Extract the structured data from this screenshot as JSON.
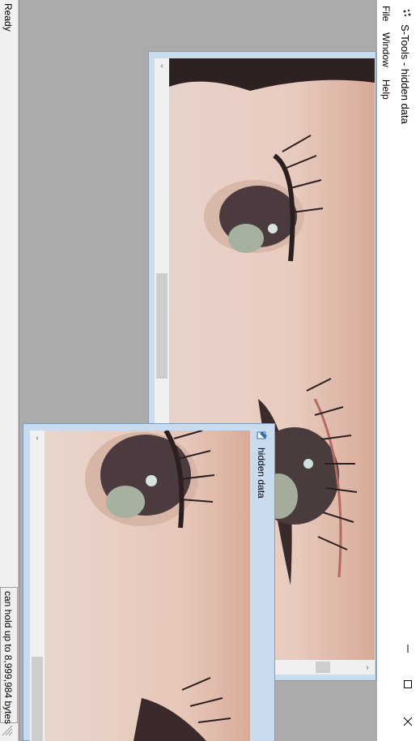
{
  "window": {
    "title": "S-Tools - hidden data",
    "icon": "app-icon"
  },
  "menu": {
    "items": [
      "File",
      "Window",
      "Help"
    ]
  },
  "status": {
    "ready": "Ready",
    "capacity": "can hold up to 8,999,984 bytes"
  },
  "child_windows": {
    "front": {
      "title": "hidden data",
      "icon": "paint-icon"
    }
  },
  "colors": {
    "mdi_background": "#ababab",
    "child_frame": "#c9dcef",
    "skin": "#e9cfc2",
    "iris": "#4b3b3f"
  }
}
